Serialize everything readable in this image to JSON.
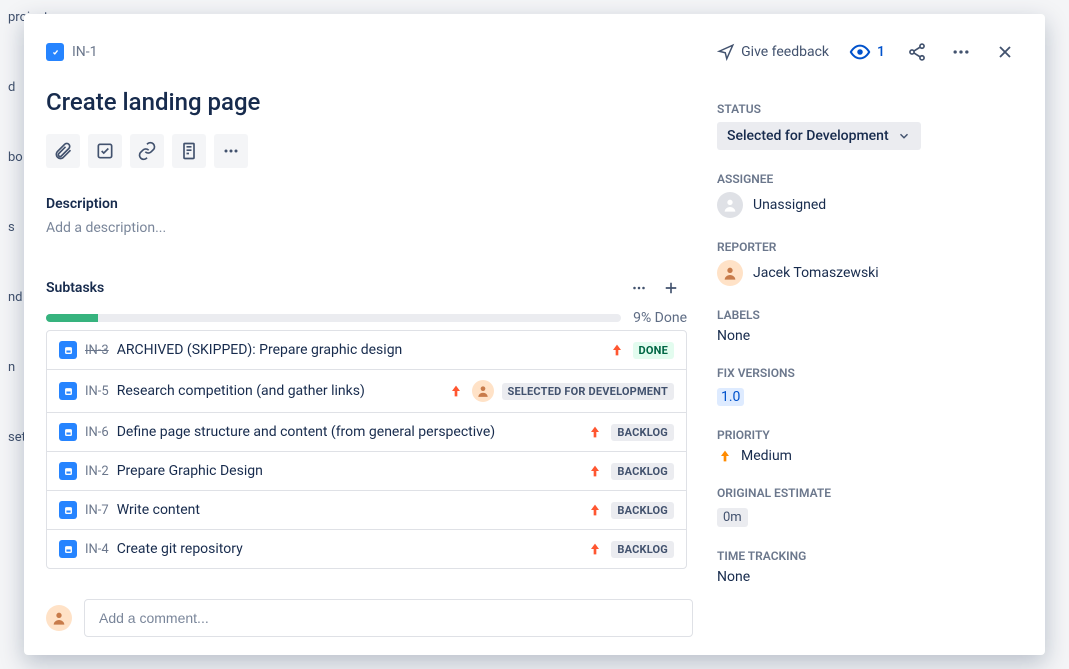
{
  "backdrop_lines": [
    "project",
    "",
    "",
    "d",
    "",
    "bo",
    "",
    "",
    "s",
    "",
    "",
    "nd",
    "",
    "",
    "n",
    "",
    "",
    "set"
  ],
  "header": {
    "issue_key": "IN-1",
    "feedback_label": "Give feedback",
    "watch_count": "1"
  },
  "title": "Create landing page",
  "description_label": "Description",
  "description_placeholder": "Add a description...",
  "subtasks_label": "Subtasks",
  "progress": {
    "percent": 9,
    "text": "9% Done"
  },
  "subtasks": [
    {
      "key": "IN-3",
      "key_strike": true,
      "title": "ARCHIVED (SKIPPED): Prepare graphic design",
      "priority": "up",
      "status_text": "DONE",
      "status_class": "status-done",
      "has_avatar": false
    },
    {
      "key": "IN-5",
      "key_strike": false,
      "title": "Research competition (and gather links)",
      "priority": "up",
      "status_text": "SELECTED FOR DEVELOPMENT",
      "status_class": "status-sfd",
      "has_avatar": true
    },
    {
      "key": "IN-6",
      "key_strike": false,
      "title": "Define page structure and content (from general perspective)",
      "priority": "up",
      "status_text": "BACKLOG",
      "status_class": "status-backlog",
      "has_avatar": false
    },
    {
      "key": "IN-2",
      "key_strike": false,
      "title": "Prepare Graphic Design",
      "priority": "up",
      "status_text": "BACKLOG",
      "status_class": "status-backlog",
      "has_avatar": false
    },
    {
      "key": "IN-7",
      "key_strike": false,
      "title": "Write content",
      "priority": "up",
      "status_text": "BACKLOG",
      "status_class": "status-backlog",
      "has_avatar": false
    },
    {
      "key": "IN-4",
      "key_strike": false,
      "title": "Create git repository",
      "priority": "up",
      "status_text": "BACKLOG",
      "status_class": "status-backlog",
      "has_avatar": false
    }
  ],
  "comment_placeholder": "Add a comment...",
  "sidebar": {
    "status_label": "STATUS",
    "status_value": "Selected for Development",
    "assignee_label": "ASSIGNEE",
    "assignee_value": "Unassigned",
    "reporter_label": "REPORTER",
    "reporter_value": "Jacek Tomaszewski",
    "labels_label": "LABELS",
    "labels_value": "None",
    "fixversions_label": "FIX VERSIONS",
    "fixversions_value": "1.0",
    "priority_label": "PRIORITY",
    "priority_value": "Medium",
    "estimate_label": "ORIGINAL ESTIMATE",
    "estimate_value": "0m",
    "tracking_label": "TIME TRACKING",
    "tracking_value": "None"
  }
}
